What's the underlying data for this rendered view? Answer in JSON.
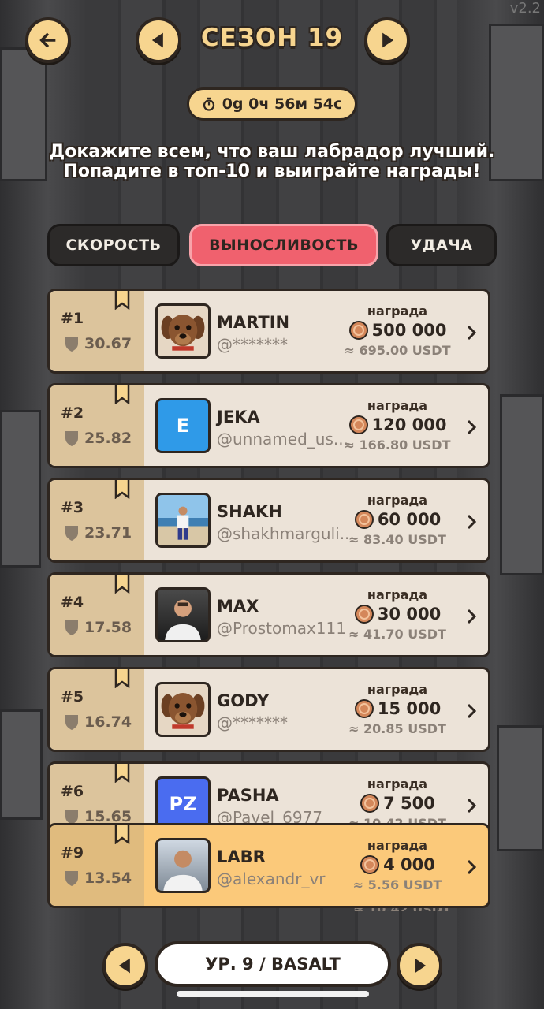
{
  "header": {
    "season_title": "СЕЗОН 19",
    "timer": "0g 0ч 56м 54с",
    "version": "v2.2"
  },
  "subtitle": "Докажите всем, что ваш лабрадор лучший. Попадите в топ-10 и выиграйте награды!",
  "tabs": [
    {
      "label": "СКОРОСТЬ",
      "active": false
    },
    {
      "label": "ВЫНОСЛИВОСТЬ",
      "active": true
    },
    {
      "label": "УДАЧА",
      "active": false
    }
  ],
  "leaderboard": [
    {
      "rank": "#1",
      "score": "30.67",
      "name": "MARTIN",
      "handle": "@*******",
      "avatar": "dog",
      "reward_label": "награда",
      "reward": "500 000",
      "usdt": "≈ 695.00 USDT"
    },
    {
      "rank": "#2",
      "score": "25.82",
      "name": "JEKA",
      "handle": "@unnamed_us...",
      "avatar": "E",
      "reward_label": "награда",
      "reward": "120 000",
      "usdt": "≈ 166.80 USDT"
    },
    {
      "rank": "#3",
      "score": "23.71",
      "name": "SHAKH",
      "handle": "@shakhmarguli...",
      "avatar": "photo-beach",
      "reward_label": "награда",
      "reward": "60 000",
      "usdt": "≈ 83.40 USDT"
    },
    {
      "rank": "#4",
      "score": "17.58",
      "name": "MAX",
      "handle": "@Prostomax111",
      "avatar": "photo-car",
      "reward_label": "награда",
      "reward": "30 000",
      "usdt": "≈ 41.70 USDT"
    },
    {
      "rank": "#5",
      "score": "16.74",
      "name": "GODY",
      "handle": "@*******",
      "avatar": "dog",
      "reward_label": "награда",
      "reward": "15 000",
      "usdt": "≈ 20.85 USDT"
    },
    {
      "rank": "#6",
      "score": "15.65",
      "name": "PASHA",
      "handle": "@Pavel_6977",
      "avatar": "PZ",
      "reward_label": "награда",
      "reward": "7 500",
      "usdt": "≈ 10.42 USDT"
    }
  ],
  "my_entry": {
    "rank": "#9",
    "score": "13.54",
    "name": "LABR",
    "handle": "@alexandr_vr",
    "reward_label": "награда",
    "reward": "4 000",
    "usdt": "≈ 5.56 USDT"
  },
  "hidden_peek": {
    "usdt": "≈ 10.42 USDT"
  },
  "footer": {
    "level": "УР. 9 / BASALT"
  },
  "colors": {
    "accent": "#f7d58f",
    "active_tab": "#f0616e",
    "card": "#ece3d8",
    "my_card": "#fbc97a",
    "avatar_e": "#2f9ae8",
    "avatar_pz": "#4a6cf0"
  }
}
